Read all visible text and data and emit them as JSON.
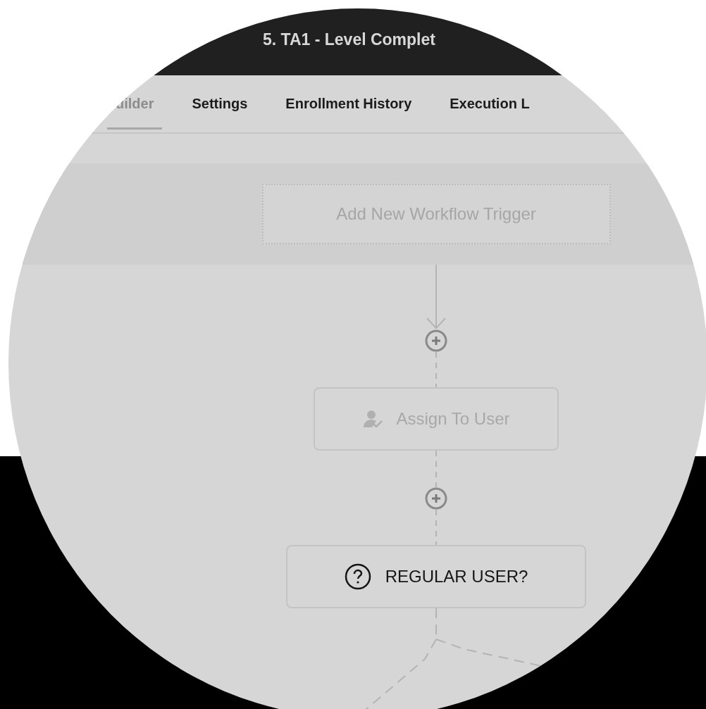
{
  "window": {
    "title": "5. TA1 - Level Complet"
  },
  "tabs": [
    {
      "label": "uilder",
      "selected": true
    },
    {
      "label": "Settings",
      "selected": false
    },
    {
      "label": "Enrollment History",
      "selected": false
    },
    {
      "label": "Execution L",
      "selected": false
    }
  ],
  "trigger": {
    "label": "Add New Workflow Trigger"
  },
  "steps": [
    {
      "kind": "action",
      "label": "Assign To User",
      "disabled": true
    },
    {
      "kind": "condition",
      "label": "REGULAR USER?",
      "disabled": false
    }
  ]
}
